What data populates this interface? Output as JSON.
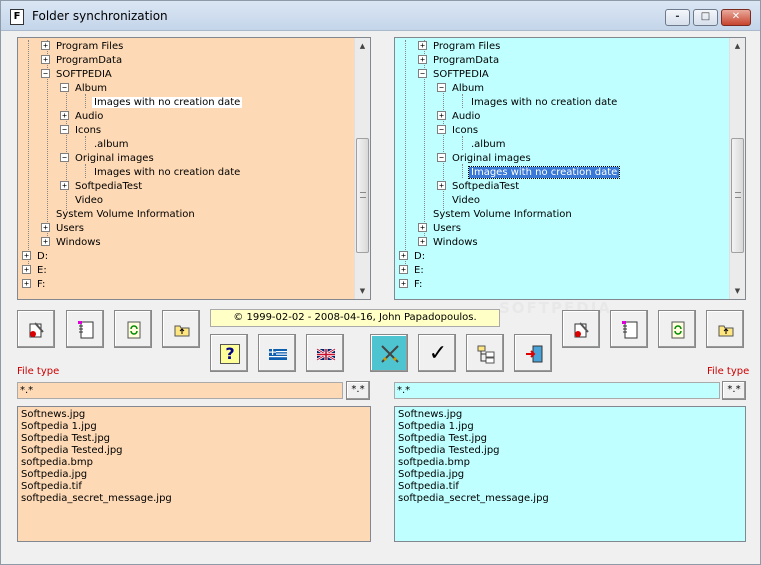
{
  "window": {
    "title": "Folder synchronization",
    "icon_glyph": "F"
  },
  "winbuttons": {
    "minimize": "-",
    "maximize": "□",
    "close": "✕"
  },
  "left_tree": [
    {
      "label": "Program Files",
      "exp": "+",
      "level": 2
    },
    {
      "label": "ProgramData",
      "exp": "+",
      "level": 2
    },
    {
      "label": "SOFTPEDIA",
      "exp": "−",
      "level": 2
    },
    {
      "label": "Album",
      "exp": "−",
      "level": 3
    },
    {
      "label": "Images with no creation date",
      "exp": "",
      "level": 4,
      "state": "selected"
    },
    {
      "label": "Audio",
      "exp": "+",
      "level": 3
    },
    {
      "label": "Icons",
      "exp": "−",
      "level": 3
    },
    {
      "label": ".album",
      "exp": "",
      "level": 4
    },
    {
      "label": "Original images",
      "exp": "−",
      "level": 3
    },
    {
      "label": "Images with no creation date",
      "exp": "",
      "level": 4
    },
    {
      "label": "SoftpediaTest",
      "exp": "+",
      "level": 3
    },
    {
      "label": "Video",
      "exp": "",
      "level": 3
    },
    {
      "label": "System Volume Information",
      "exp": "",
      "level": 2
    },
    {
      "label": "Users",
      "exp": "+",
      "level": 2
    },
    {
      "label": "Windows",
      "exp": "+",
      "level": 2
    },
    {
      "label": "D:",
      "exp": "+",
      "level": 1
    },
    {
      "label": "E:",
      "exp": "+",
      "level": 1
    },
    {
      "label": "F:",
      "exp": "+",
      "level": 1
    }
  ],
  "right_tree": [
    {
      "label": "Program Files",
      "exp": "+",
      "level": 2
    },
    {
      "label": "ProgramData",
      "exp": "+",
      "level": 2
    },
    {
      "label": "SOFTPEDIA",
      "exp": "−",
      "level": 2
    },
    {
      "label": "Album",
      "exp": "−",
      "level": 3
    },
    {
      "label": "Images with no creation date",
      "exp": "",
      "level": 4
    },
    {
      "label": "Audio",
      "exp": "+",
      "level": 3
    },
    {
      "label": "Icons",
      "exp": "−",
      "level": 3
    },
    {
      "label": ".album",
      "exp": "",
      "level": 4
    },
    {
      "label": "Original images",
      "exp": "−",
      "level": 3
    },
    {
      "label": "Images with no creation date",
      "exp": "",
      "level": 4,
      "state": "highlighted"
    },
    {
      "label": "SoftpediaTest",
      "exp": "+",
      "level": 3
    },
    {
      "label": "Video",
      "exp": "",
      "level": 3
    },
    {
      "label": "System Volume Information",
      "exp": "",
      "level": 2
    },
    {
      "label": "Users",
      "exp": "+",
      "level": 2
    },
    {
      "label": "Windows",
      "exp": "+",
      "level": 2
    },
    {
      "label": "D:",
      "exp": "+",
      "level": 1
    },
    {
      "label": "E:",
      "exp": "+",
      "level": 1
    },
    {
      "label": "F:",
      "exp": "+",
      "level": 1
    }
  ],
  "copyright": "© 1999-02-02 - 2008-04-16, John Papadopoulos.",
  "watermark": "SOFTPEDIA",
  "left_filter": {
    "label": "File type",
    "value": "*.*",
    "button": "*.*"
  },
  "right_filter": {
    "label": "File type",
    "value": "*.*",
    "button": "*.*"
  },
  "left_files": [
    "Softnews.jpg",
    "Softpedia 1.jpg",
    "Softpedia Test.jpg",
    "Softpedia Tested.jpg",
    "softpedia.bmp",
    "Softpedia.jpg",
    "Softpedia.tif",
    "softpedia_secret_message.jpg"
  ],
  "right_files": [
    "Softnews.jpg",
    "Softpedia 1.jpg",
    "Softpedia Test.jpg",
    "Softpedia Tested.jpg",
    "softpedia.bmp",
    "Softpedia.jpg",
    "Softpedia.tif",
    "softpedia_secret_message.jpg"
  ],
  "help_glyph": "?",
  "check_glyph": "✓",
  "colors": {
    "left_panel": "#fdd9b5",
    "right_panel": "#bfffff",
    "label_red": "#cc0000",
    "copyright_bg": "#ffffc6",
    "selection": "#3a7ad6"
  }
}
